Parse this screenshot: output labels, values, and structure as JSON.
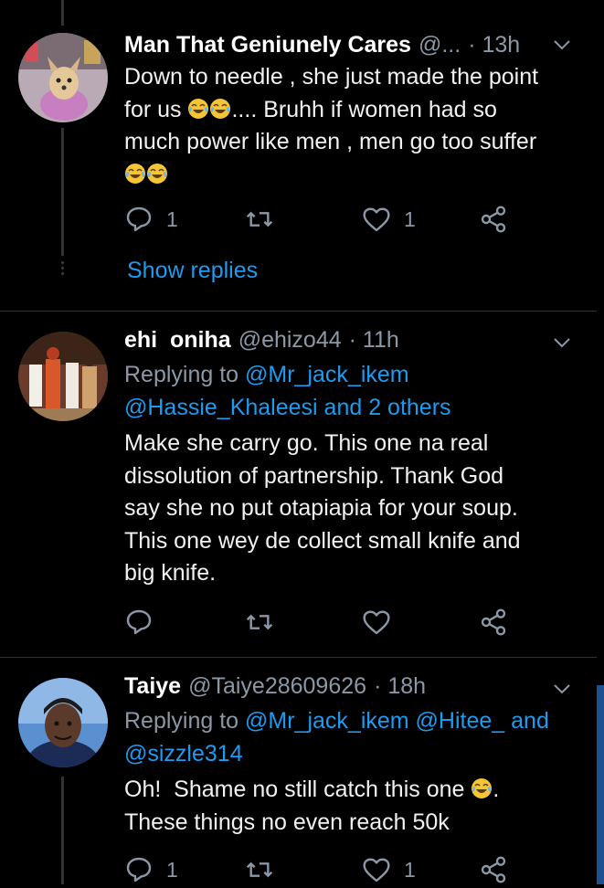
{
  "tweets": [
    {
      "name": "Man That Geniunely Cares",
      "handle": "@...",
      "time": "· 13h",
      "lines": [
        "Down to needle , she just made the point",
        "for us",
        ".... Bruhh if women had so",
        "much power like men , men go too suffer"
      ],
      "actions": {
        "reply_count": "1",
        "retweet_count": "",
        "like_count": "1"
      },
      "show_replies": "Show replies"
    },
    {
      "name": "ehi  oniha",
      "handle": "@ehizo44",
      "time": "· 11h",
      "replying_label": "Replying to",
      "replying_mentions_line1": "@Mr_jack_ikem",
      "replying_mentions_line2": "@Hassie_Khaleesi and 2 others",
      "lines": [
        "Make she carry go. This one na real",
        "dissolution of partnership. Thank God",
        "say she no put otapiapia for your soup.",
        "This one wey de collect small knife and",
        "big knife."
      ],
      "actions": {
        "reply_count": "",
        "retweet_count": "",
        "like_count": ""
      }
    },
    {
      "name": "Taiye",
      "handle": "@Taiye28609626",
      "time": "· 18h",
      "replying_label": "Replying to",
      "replying_mentions_line1": "@Mr_jack_ikem @Hitee_ and",
      "replying_mentions_line2": "@sizzle314",
      "lines": [
        "Oh!  Shame no still catch this one",
        ".",
        "These things no even reach 50k"
      ],
      "actions": {
        "reply_count": "1",
        "retweet_count": "",
        "like_count": "1"
      }
    }
  ],
  "colors": {
    "background": "#000000",
    "link": "#1d9bf0",
    "muted": "#8b98a5",
    "divider": "#2f3336"
  },
  "icons": [
    "reply-icon",
    "retweet-icon",
    "like-icon",
    "share-icon",
    "chevron-down-icon",
    "joy-emoji-icon"
  ]
}
